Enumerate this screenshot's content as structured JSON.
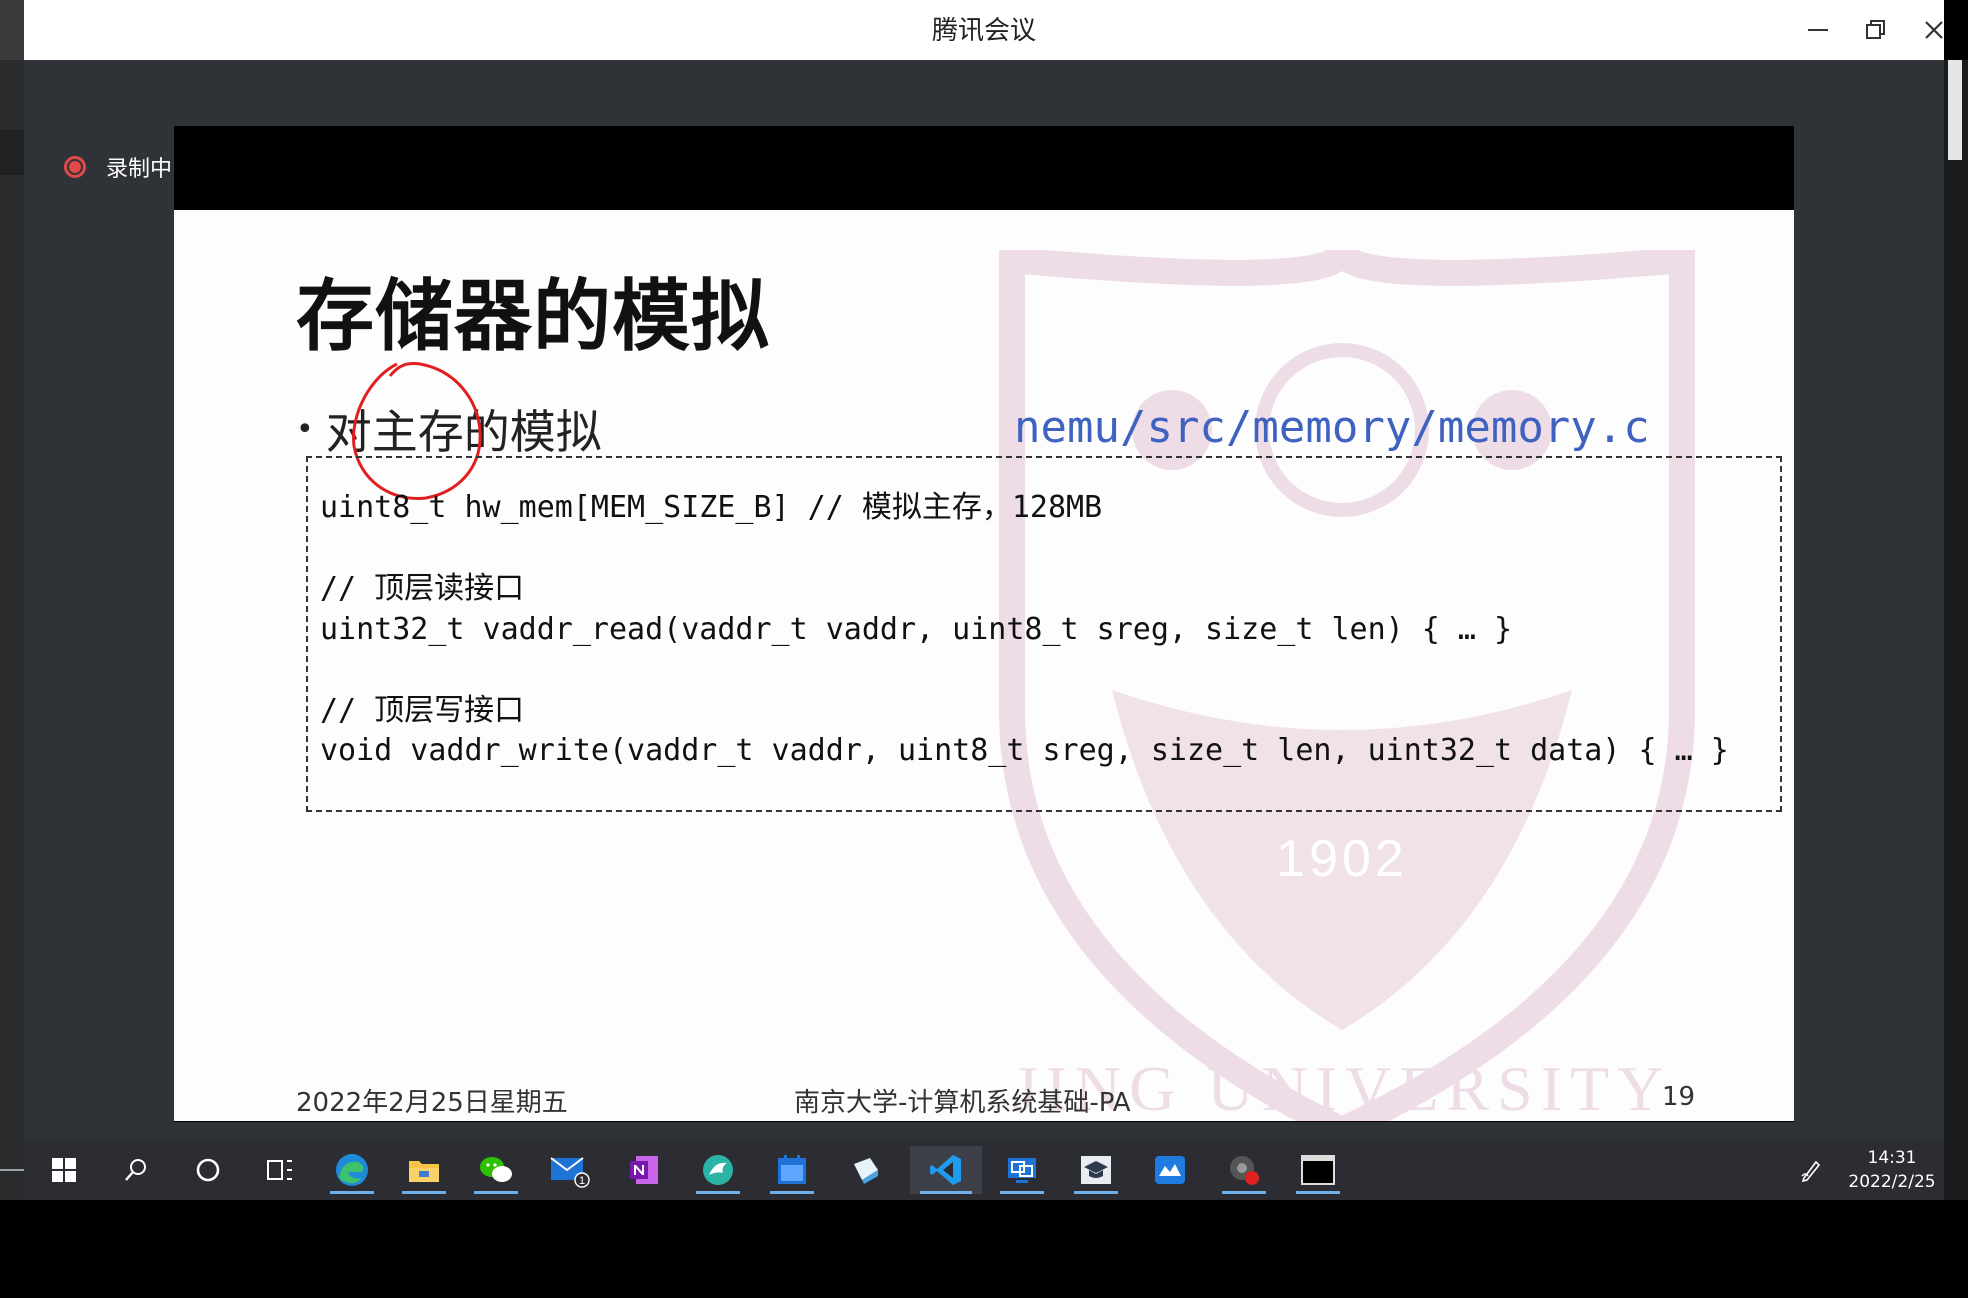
{
  "window": {
    "title": "腾讯会议"
  },
  "recording": {
    "label": "录制中"
  },
  "slide": {
    "title": "存储器的模拟",
    "bullet_marker": "•",
    "bullet_text": "对主存的模拟",
    "file_path": "nemu/src/memory/memory.c",
    "code_lines": [
      "uint8_t hw_mem[MEM_SIZE_B] // 模拟主存，128MB",
      "",
      "// 顶层读接口",
      "uint32_t vaddr_read(vaddr_t vaddr, uint8_t sreg, size_t len) { … }",
      "",
      "// 顶层写接口",
      "void vaddr_write(vaddr_t vaddr, uint8_t sreg, size_t len, uint32_t data) { … }"
    ],
    "footer_date": "2022年2月25日星期五",
    "footer_center": "南京大学-计算机系统基础-PA",
    "page_number": "19",
    "watermark_year": "1902",
    "watermark_text": "JING UNIVERSITY"
  },
  "taskbar": {
    "apps": [
      "start-icon",
      "search-icon",
      "cortana-icon",
      "task-view-icon",
      "edge-icon",
      "file-explorer-icon",
      "wechat-icon",
      "mail-icon",
      "onenote-icon",
      "app-bird-icon",
      "calendar-icon",
      "app-paper-icon",
      "vscode-icon",
      "remote-desktop-icon",
      "app-graduation-icon",
      "app-cloud-icon",
      "app-record-icon",
      "terminal-icon"
    ],
    "mail_badge": "1",
    "time": "14:31",
    "date": "2022/2/25"
  },
  "colors": {
    "path_blue": "#3f62c0",
    "record_red": "#e24a4a",
    "taskbar_bg": "#2b2d33",
    "watermark_pink": "#eedde6"
  }
}
